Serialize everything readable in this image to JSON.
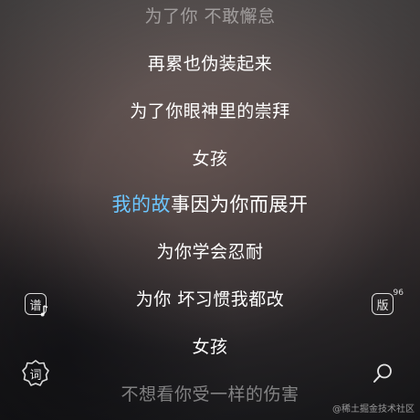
{
  "lyrics": [
    {
      "text": "为了你 不敢懈怠",
      "state": "faded"
    },
    {
      "text": "再累也伪装起来",
      "state": "normal"
    },
    {
      "text": "为了你眼神里的崇拜",
      "state": "normal"
    },
    {
      "text": "女孩",
      "state": "normal"
    },
    {
      "sung": "我的故",
      "rest": "事因为你而展开",
      "state": "current"
    },
    {
      "text": "为你学会忍耐",
      "state": "normal"
    },
    {
      "text": "为你 坏习惯我都改",
      "state": "normal"
    },
    {
      "text": "女孩",
      "state": "normal"
    },
    {
      "text": "不想看你受一样的伤害",
      "state": "faded"
    }
  ],
  "controls": {
    "score_button_label": "谱",
    "lyrics_button_label": "词",
    "version_button_label": "版",
    "version_count": "96",
    "search_icon": "search-icon"
  },
  "watermark": "@稀土掘金技术社区",
  "colors": {
    "highlight": "#6cc6ff",
    "text": "#ffffff"
  }
}
